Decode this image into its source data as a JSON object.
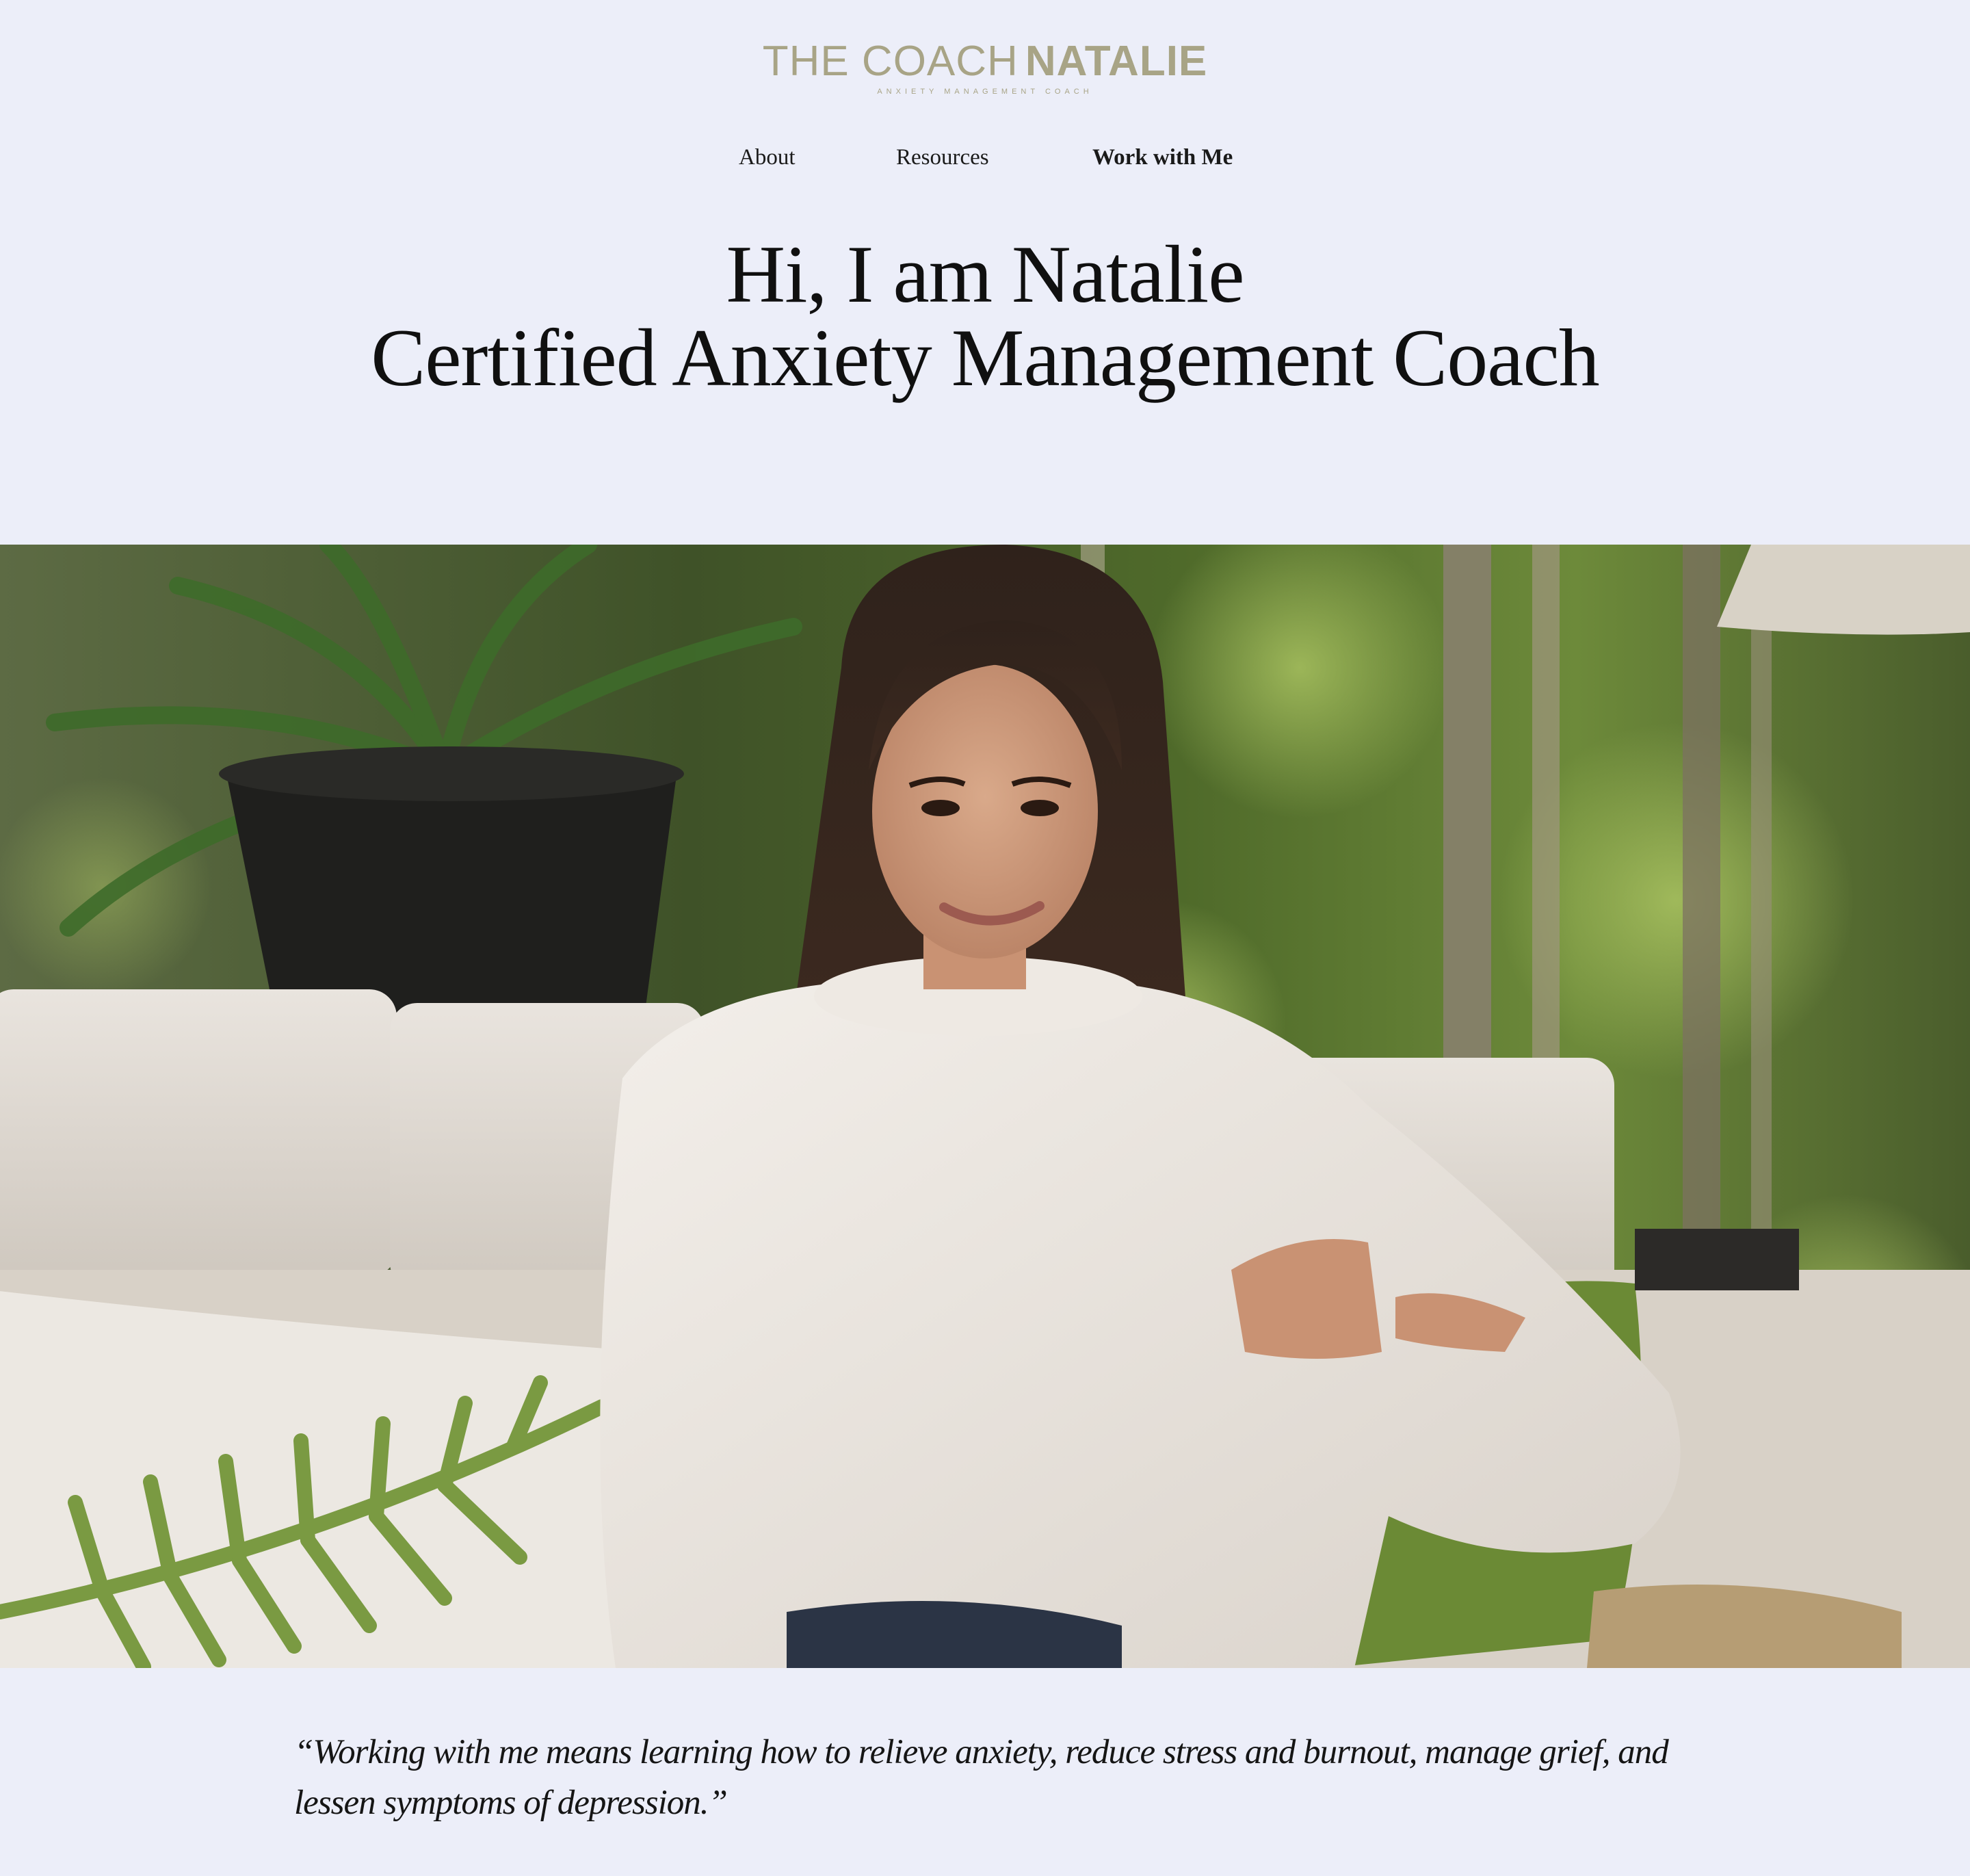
{
  "brand": {
    "title_light": "THE COACH",
    "title_bold": "NATALIE",
    "tagline": "ANXIETY MANAGEMENT COACH",
    "color": "#a8a486"
  },
  "nav": {
    "about": "About",
    "resources": "Resources",
    "work_with_me": "Work with Me"
  },
  "hero": {
    "line1": "Hi, I am Natalie",
    "line2": "Certified Anxiety Management Coach"
  },
  "photo": {
    "subject": "portrait-photo"
  },
  "quote": {
    "text": "“Working with me means learning how to relieve anxiety, reduce stress and burnout, manage grief, and lessen symptoms of depression.”"
  },
  "colors": {
    "background": "#eceef9",
    "text": "#111111"
  }
}
